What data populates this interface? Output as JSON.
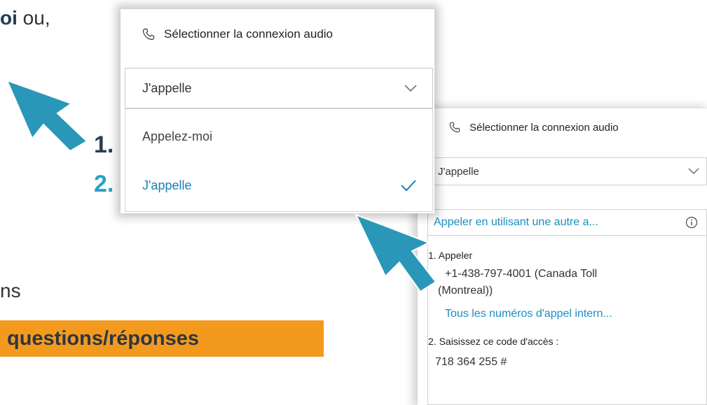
{
  "slide": {
    "top_text_bold": "oi",
    "top_text_rest": " ou,",
    "mid_text": "ns",
    "highlight_text": "questions/réponses",
    "step1": "1.",
    "step2": "2."
  },
  "colors": {
    "arrow": "#2a97b8",
    "highlight": "#f39a1e",
    "link": "#1a8fc0"
  },
  "panel1": {
    "header_icon": "phone-icon",
    "header": "Sélectionner la connexion audio",
    "select_value": "J'appelle",
    "options": [
      {
        "label": "Appelez-moi",
        "selected": false
      },
      {
        "label": "J'appelle",
        "selected": true
      }
    ]
  },
  "panel2": {
    "header_icon": "phone-icon",
    "header": "Sélectionner la connexion audio",
    "select_value": "J'appelle",
    "other_call": "Appeler en utilisant une autre a...",
    "step1_label": "1. Appeler",
    "phone_line1": "+1-438-797-4001 (Canada Toll",
    "phone_line2": "(Montreal))",
    "all_numbers_link": "Tous les numéros d'appel intern...",
    "step2_label": "2. Saisissez ce code d'accès :",
    "access_code": "718 364 255 #"
  }
}
